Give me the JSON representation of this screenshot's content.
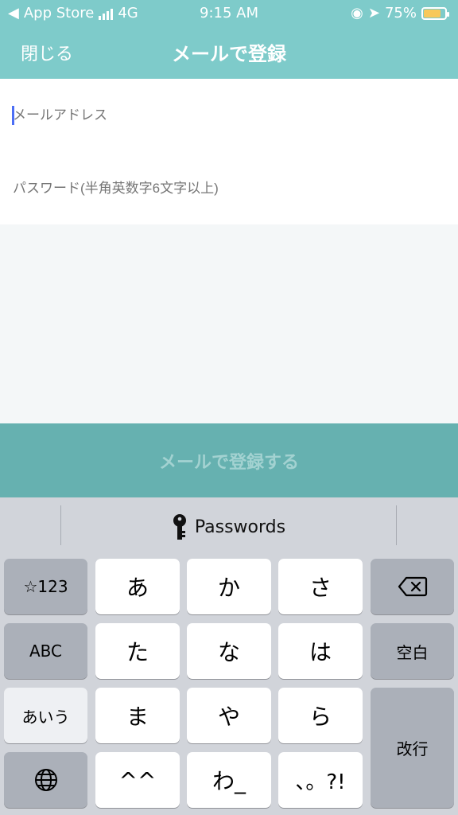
{
  "status": {
    "back_app": "App Store",
    "network": "4G",
    "time": "9:15 AM",
    "battery": "75%"
  },
  "nav": {
    "close": "閉じる",
    "title": "メールで登録"
  },
  "form": {
    "email_placeholder": "メールアドレス",
    "password_placeholder": "パスワード(半角英数字6文字以上)"
  },
  "action": {
    "label": "メールで登録する"
  },
  "keyboard": {
    "suggestion": "Passwords",
    "keys": {
      "sym": "☆123",
      "a": "あ",
      "ka": "か",
      "sa": "さ",
      "abc": "ABC",
      "ta": "た",
      "na": "な",
      "ha": "は",
      "space": "空白",
      "kana": "あいう",
      "ma": "ま",
      "ya": "や",
      "ra": "ら",
      "enter": "改行",
      "emoticon": "^^",
      "wa": "わ_",
      "punct": "、。?!"
    }
  },
  "colors": {
    "accent": "#7ecbca",
    "button": "#66b1b0"
  }
}
